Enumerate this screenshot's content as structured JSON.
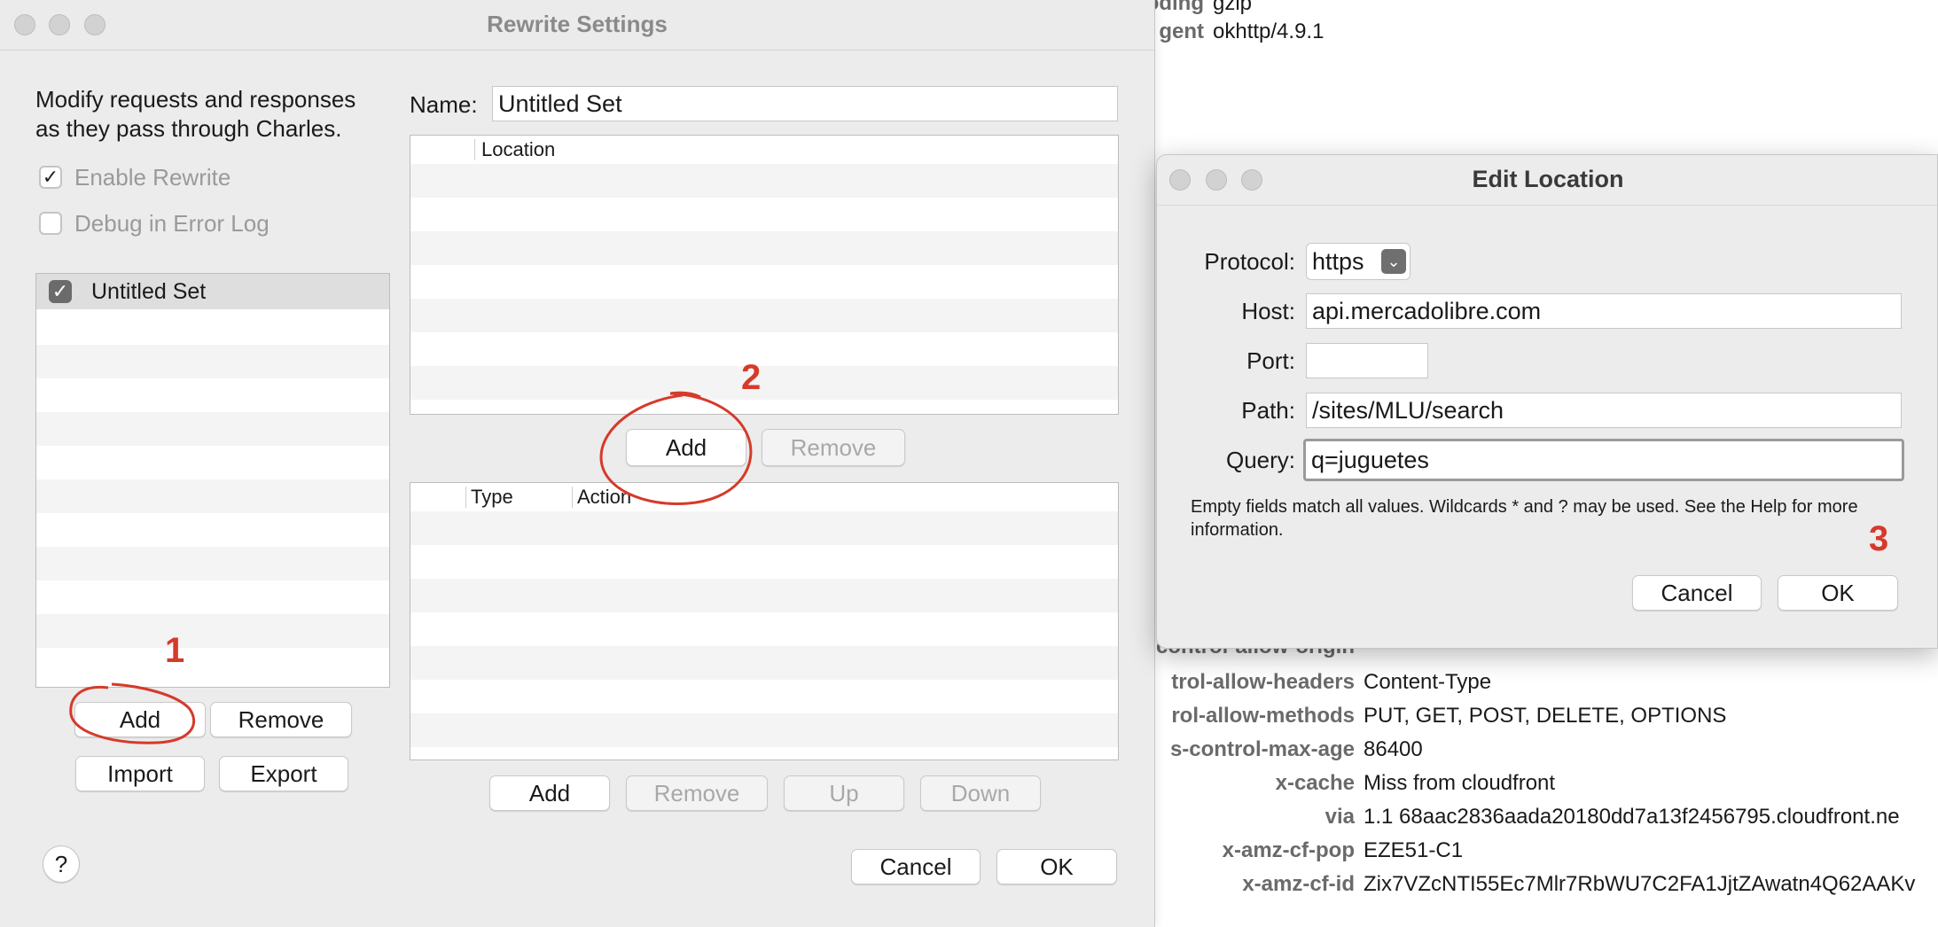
{
  "background": {
    "top_rows": [
      {
        "key": "oding",
        "value": "gzip"
      },
      {
        "key": "gent",
        "value": "okhttp/4.9.1"
      }
    ],
    "bottom_rows": [
      {
        "key": "control-allow-origin",
        "value": ""
      },
      {
        "key": "trol-allow-headers",
        "value": "Content-Type"
      },
      {
        "key": "rol-allow-methods",
        "value": "PUT, GET, POST, DELETE, OPTIONS"
      },
      {
        "key": "s-control-max-age",
        "value": "86400"
      },
      {
        "key": "x-cache",
        "value": "Miss from cloudfront"
      },
      {
        "key": "via",
        "value": "1.1 68aac2836aada20180dd7a13f2456795.cloudfront.ne"
      },
      {
        "key": "x-amz-cf-pop",
        "value": "EZE51-C1"
      },
      {
        "key": "x-amz-cf-id",
        "value": "Zix7VZcNTI55Ec7Mlr7RbWU7C2FA1JjtZAwatn4Q62AAKv"
      }
    ]
  },
  "rewrite": {
    "title": "Rewrite Settings",
    "description_line1": "Modify requests and responses",
    "description_line2": "as they pass through Charles.",
    "enable_label": "Enable Rewrite",
    "enable_checked": "✓",
    "debug_label": "Debug in Error Log",
    "sets": [
      {
        "name": "Untitled Set",
        "checked": "✓"
      }
    ],
    "set_buttons": {
      "add": "Add",
      "remove": "Remove",
      "import": "Import",
      "export": "Export"
    },
    "name_label": "Name:",
    "name_value": "Untitled Set",
    "location_header": "Location",
    "location_buttons": {
      "add": "Add",
      "remove": "Remove"
    },
    "rules_headers": {
      "type": "Type",
      "action": "Action"
    },
    "rules_buttons": {
      "add": "Add",
      "remove": "Remove",
      "up": "Up",
      "down": "Down"
    },
    "help": "?",
    "cancel": "Cancel",
    "ok": "OK"
  },
  "edit_location": {
    "title": "Edit Location",
    "protocol_label": "Protocol:",
    "protocol_value": "https",
    "host_label": "Host:",
    "host_value": "api.mercadolibre.com",
    "port_label": "Port:",
    "port_value": "",
    "path_label": "Path:",
    "path_value": "/sites/MLU/search",
    "query_label": "Query:",
    "query_value": "q=juguetes",
    "note": "Empty fields match all values. Wildcards * and ? may be used. See the Help for more information.",
    "cancel": "Cancel",
    "ok": "OK"
  },
  "annotations": {
    "step1": "1",
    "step2": "2",
    "step3": "3",
    "color": "#d63a2a"
  }
}
